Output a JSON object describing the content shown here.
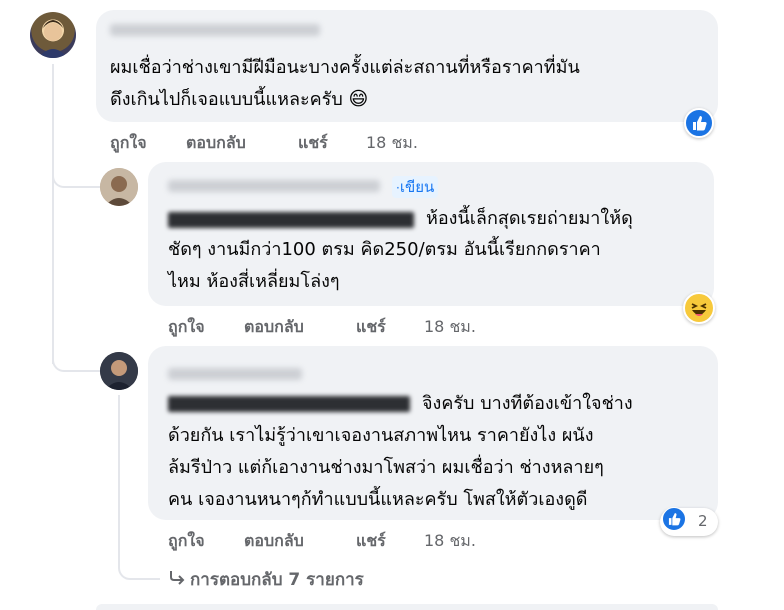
{
  "comments": [
    {
      "text_lines": [
        "ผมเชื่อว่าช่างเขามีฝีมือนะบางครั้งแต่ล่ะสถานที่หรือราคาที่มัน",
        "ดึงเกินไปก็เจอแบบนี้แหละครับ"
      ],
      "emoji": "😄",
      "actions": {
        "like": "ถูกใจ",
        "reply": "ตอบกลับ",
        "share": "แชร์",
        "time": "18 ชม."
      },
      "reaction": "like-icon"
    },
    {
      "tag": "เขียน",
      "text_lines": [
        "ห้องนี้เล็กสุดเรยถ่ายมาให้ดุ",
        "ชัดๆ งานมีกว่า100 ตรม คิด250/ตรม อันนี้เรียกกดราคา",
        "ไหม ห้องสี่เหลี่ยมโล่งๆ"
      ],
      "actions": {
        "like": "ถูกใจ",
        "reply": "ตอบกลับ",
        "share": "แชร์",
        "time": "18 ชม."
      },
      "reaction": "haha-icon"
    },
    {
      "text_lines": [
        "จิงครับ บางทีต้องเข้าใจช่าง",
        "ด้วยกัน เราไม่รู้ว่าเขาเจองานสภาพไหน ราคายังไง ผนัง",
        "ล้มรีป่าว แต่ก้เอางานช่างมาโพสว่า ผมเชื่อว่า ช่างหลายๆ",
        "คน เจองานหนาๆก้ทำแบบนี้แหละครับ โพสให้ตัวเองดูดี"
      ],
      "actions": {
        "like": "ถูกใจ",
        "reply": "ตอบกลับ",
        "share": "แชร์",
        "time": "18 ชม."
      },
      "reaction": "like-icon",
      "reaction_count": "2"
    }
  ],
  "replies_link": "การตอบกลับ 7 รายการ",
  "colors": {
    "bubble": "#f0f2f5",
    "meta": "#65676b",
    "link": "#1877f2",
    "like": "#1b74e4",
    "haha": "#f7c93b"
  }
}
